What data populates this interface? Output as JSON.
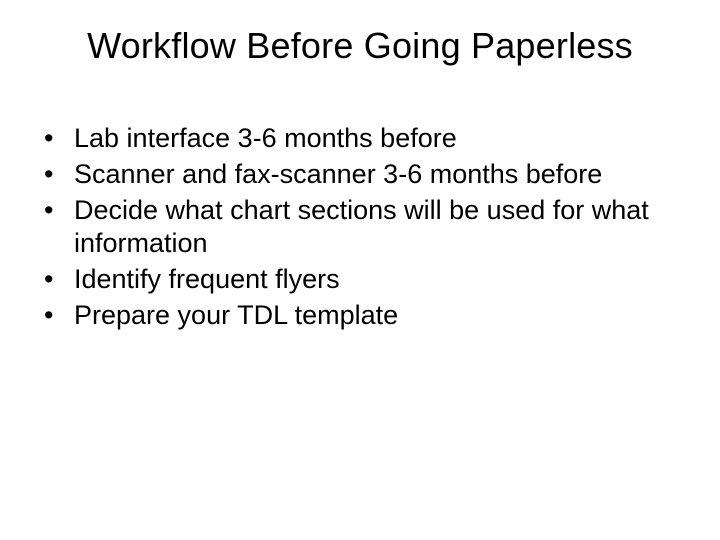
{
  "slide": {
    "title": "Workflow  Before Going Paperless",
    "bullets": [
      "Lab interface 3-6 months before",
      "Scanner and fax-scanner 3-6 months before",
      "Decide what chart sections will be used for what information",
      "Identify frequent flyers",
      "Prepare your TDL template"
    ]
  }
}
